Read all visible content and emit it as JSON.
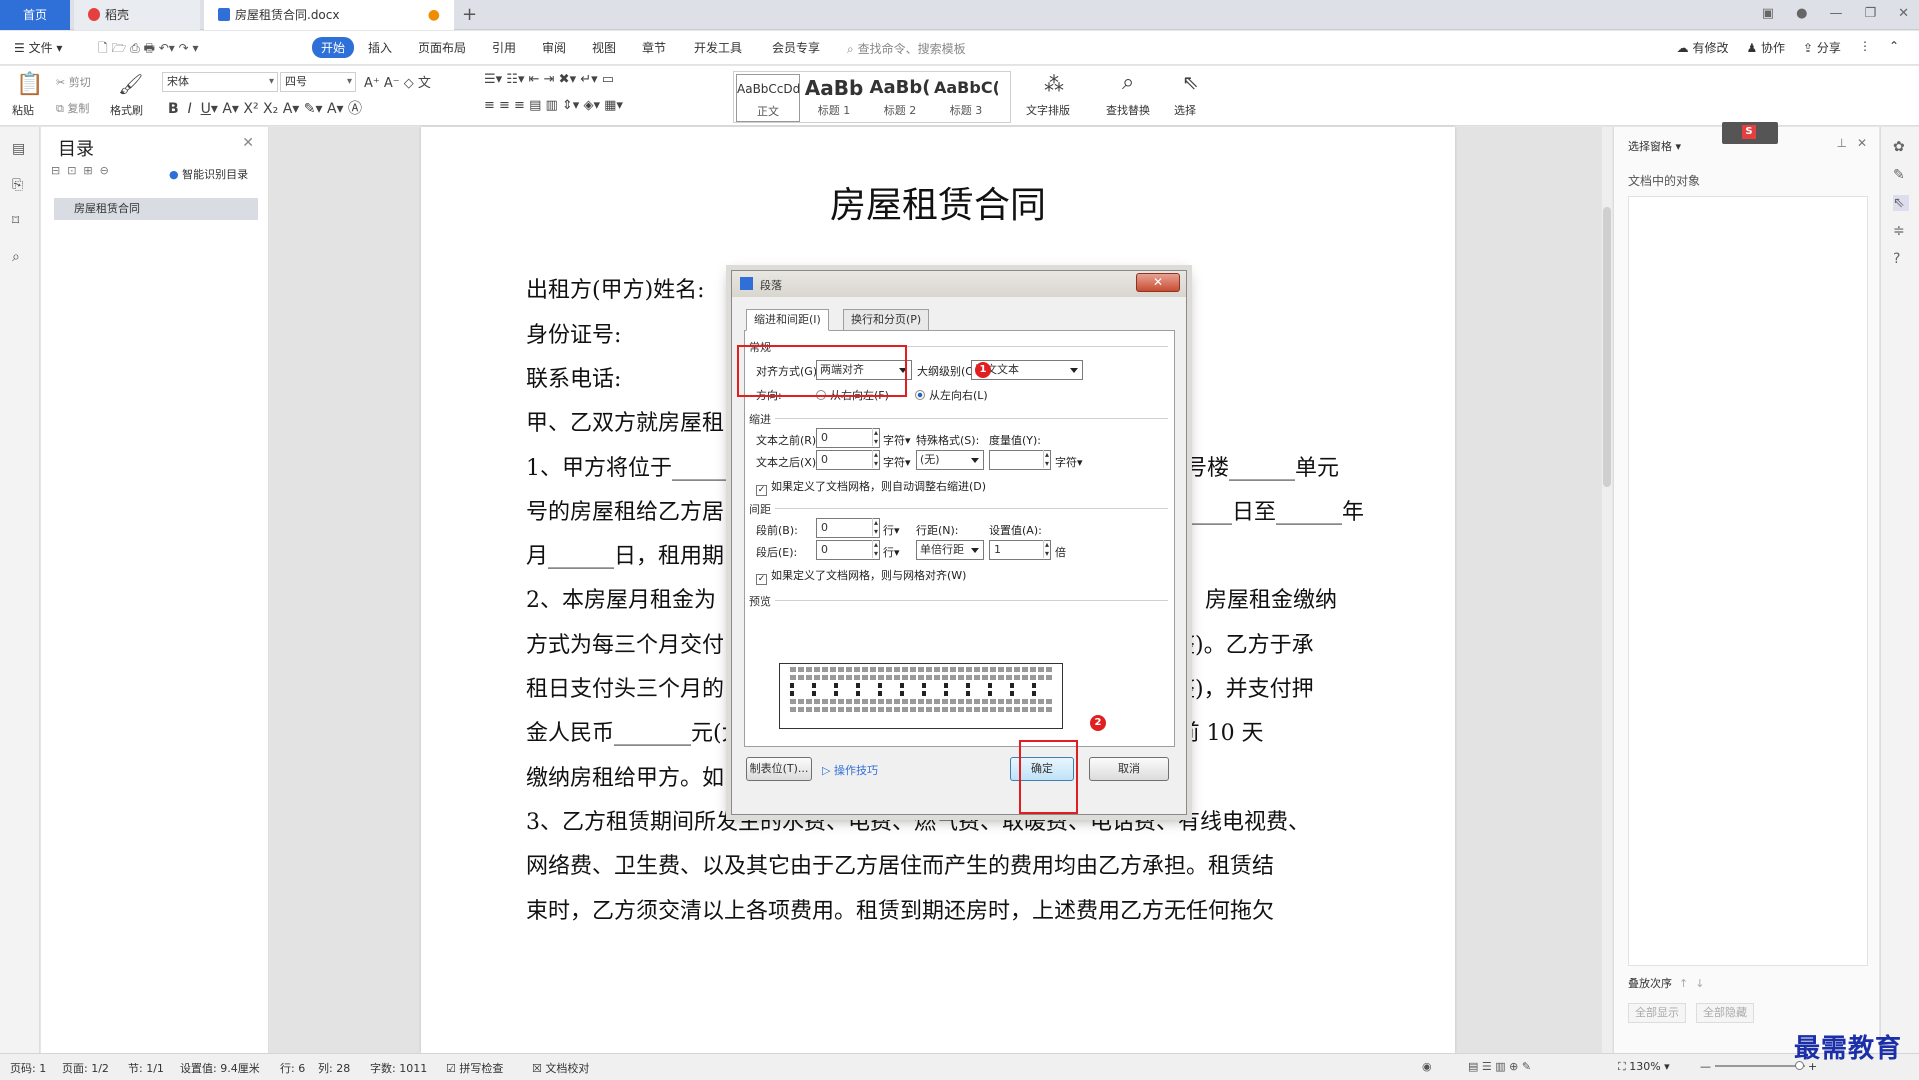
{
  "tabs": {
    "home": "首页",
    "shell": "稻壳",
    "doc": "房屋租赁合同.docx"
  },
  "menu": {
    "file": "文件",
    "start": "开始",
    "insert": "插入",
    "layout": "页面布局",
    "ref": "引用",
    "review": "审阅",
    "view": "视图",
    "section": "章节",
    "dev": "开发工具",
    "member": "会员专享",
    "search": "查找命令、搜索模板",
    "modified": "有修改",
    "collab": "协作",
    "share": "分享"
  },
  "ribbon": {
    "paste": "粘贴",
    "cut": "剪切",
    "copy": "复制",
    "format_painter": "格式刷",
    "font": "宋体",
    "size": "四号",
    "style_normal_big": "AaBbCcDd",
    "style_normal": "正文",
    "style_h1_big": "AaBb",
    "style_h1": "标题 1",
    "style_h2_big": "AaBb(",
    "style_h2": "标题 2",
    "style_h3_big": "AaBbC(",
    "style_h3": "标题 3",
    "text_layout": "文字排版",
    "find_replace": "查找替换",
    "select": "选择"
  },
  "toc": {
    "title": "目录",
    "smart": "智能识别目录",
    "item": "房屋租赁合同"
  },
  "doc": {
    "title": "房屋租赁合同",
    "lines": [
      "出租方(甲方)姓名:",
      "身份证号:",
      "联系电话:",
      "甲、乙双方就房屋租",
      "1、甲方将位于______",
      "号的房屋租给乙方居",
      "月______日，租用期",
      "2、本房屋月租金为",
      "方式为每三个月交付",
      "租日支付头三个月的",
      "金人民币_______元(大写:______整)。乙方负责在每三个月房租到期前 10 天",
      "缴纳房租给甲方。如乙方逾期不缴房租，甲方有权收回房屋。",
      "3、乙方租赁期间所发生的水费、电费、燃气费、取暖费、电话费、有线电视费、",
      "网络费、卫生费、以及其它由于乙方居住而产生的费用均由乙方承担。租赁结",
      "束时，乙方须交清以上各项费用。租赁到期还房时，上述费用乙方无任何拖欠"
    ],
    "right_frags": [
      "号楼______单元",
      "______日至______年",
      "房屋租金缴纳",
      "整)。乙方于承",
      "整)，并支付押"
    ]
  },
  "dialog": {
    "title": "段落",
    "tab1": "缩进和间距(I)",
    "tab2": "换行和分页(P)",
    "general": "常规",
    "align_label": "对齐方式(G):",
    "align_value": "两端对齐",
    "outline_label": "大纲级别(O):",
    "outline_value": "正文文本",
    "direction": "方向:",
    "rtl": "从右向左(F)",
    "ltr": "从左向右(L)",
    "indent": "缩进",
    "before_text": "文本之前(R):",
    "after_text": "文本之后(X):",
    "before_val": "0",
    "after_val": "0",
    "unit_char": "字符▾",
    "special": "特殊格式(S):",
    "special_val": "(无)",
    "measure": "度量值(Y):",
    "grid_indent": "如果定义了文档网格，则自动调整右缩进(D)",
    "spacing": "间距",
    "space_before": "段前(B):",
    "space_after": "段后(E):",
    "sb_val": "0",
    "sa_val": "0",
    "unit_line": "行▾",
    "line_spacing": "行距(N):",
    "line_spacing_val": "单倍行距",
    "set_value": "设置值(A):",
    "set_val": "1",
    "times": "倍",
    "grid_align": "如果定义了文档网格，则与网格对齐(W)",
    "preview": "预览",
    "tabs_btn": "制表位(T)...",
    "tips": "操作技巧",
    "ok": "确定",
    "cancel": "取消",
    "badge1": "1",
    "badge2": "2"
  },
  "selpane": {
    "title": "选择窗格",
    "sub": "文档中的对象",
    "stack": "叠放次序",
    "show_all": "全部显示",
    "hide_all": "全部隐藏"
  },
  "status": {
    "page": "页码: 1",
    "pages": "页面: 1/2",
    "section": "节: 1/1",
    "setting": "设置值: 9.4厘米",
    "row": "行: 6",
    "col": "列: 28",
    "words": "字数: 1011",
    "spell": "拼写检查",
    "proof": "文档校对",
    "zoom": "130%"
  },
  "watermark": "最需教育"
}
